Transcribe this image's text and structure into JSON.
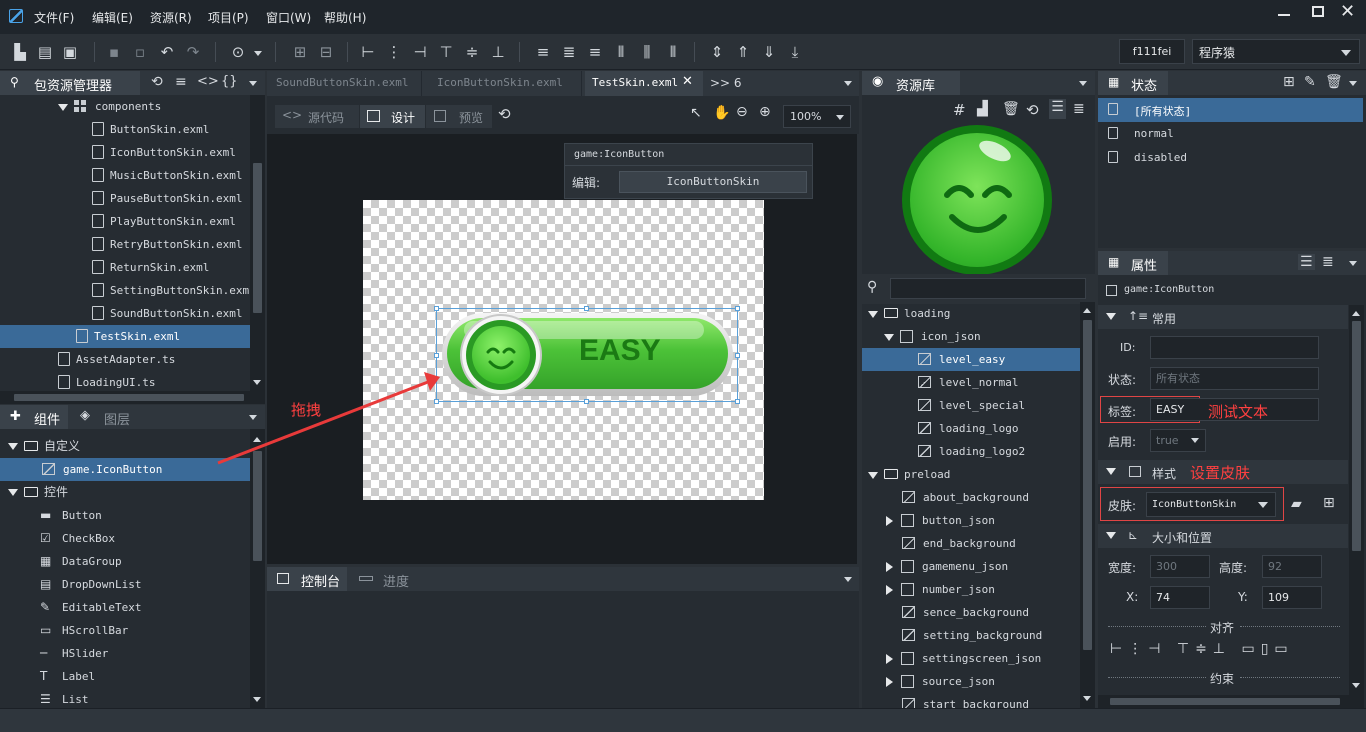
{
  "menu": [
    "文件(F)",
    "编辑(E)",
    "资源(R)",
    "项目(P)",
    "窗口(W)",
    "帮助(H)"
  ],
  "toolbar": {
    "user": "f111fei",
    "mode": "程序猿"
  },
  "package_panel": {
    "title": "包资源管理器",
    "folder": "components",
    "files": [
      "ButtonSkin.exml",
      "IconButtonSkin.exml",
      "MusicButtonSkin.exml",
      "PauseButtonSkin.exml",
      "PlayButtonSkin.exml",
      "RetryButtonSkin.exml",
      "ReturnSkin.exml",
      "SettingButtonSkin.exml",
      "SoundButtonSkin.exml"
    ],
    "selected_file": "TestSkin.exml",
    "ts_files": [
      "AssetAdapter.ts",
      "LoadingUI.ts"
    ]
  },
  "components_panel": {
    "tab_components": "组件",
    "tab_layers": "图层",
    "custom_group": "自定义",
    "custom_item": "game.IconButton",
    "controls_group": "控件",
    "controls": [
      "Button",
      "CheckBox",
      "DataGroup",
      "DropDownList",
      "EditableText",
      "HScrollBar",
      "HSlider",
      "Label",
      "List"
    ]
  },
  "editor": {
    "tabs": [
      "SoundButtonSkin.exml",
      "IconButtonSkin.exml",
      "TestSkin.exml"
    ],
    "overflow": ">> 6",
    "mode_source": "源代码",
    "mode_design": "设计",
    "mode_preview": "预览",
    "zoom": "100%",
    "popup_title": "game:IconButton",
    "popup_label": "编辑:",
    "popup_value": "IconButtonSkin",
    "button_text": "EASY",
    "drag_annotation": "拖拽"
  },
  "console": {
    "tab_console": "控制台",
    "tab_progress": "进度"
  },
  "resource_panel": {
    "title": "资源库",
    "tree": [
      {
        "label": "loading",
        "type": "folder"
      },
      {
        "label": "icon_json",
        "type": "group"
      },
      {
        "label": "level_easy",
        "type": "image",
        "selected": true
      },
      {
        "label": "level_normal",
        "type": "image"
      },
      {
        "label": "level_special",
        "type": "image"
      },
      {
        "label": "loading_logo",
        "type": "image"
      },
      {
        "label": "loading_logo2",
        "type": "image"
      },
      {
        "label": "preload",
        "type": "folder"
      },
      {
        "label": "about_background",
        "type": "image"
      },
      {
        "label": "button_json",
        "type": "group"
      },
      {
        "label": "end_background",
        "type": "image"
      },
      {
        "label": "gamemenu_json",
        "type": "group"
      },
      {
        "label": "number_json",
        "type": "group"
      },
      {
        "label": "sence_background",
        "type": "image"
      },
      {
        "label": "setting_background",
        "type": "image"
      },
      {
        "label": "settingscreen_json",
        "type": "group"
      },
      {
        "label": "source_json",
        "type": "group"
      },
      {
        "label": "start_background",
        "type": "image"
      }
    ]
  },
  "state_panel": {
    "title": "状态",
    "states": [
      "[所有状态]",
      "normal",
      "disabled"
    ]
  },
  "props_panel": {
    "title": "属性",
    "component": "game:IconButton",
    "section_common": "常用",
    "id_label": "ID:",
    "id_value": "",
    "state_label": "状态:",
    "state_placeholder": "所有状态",
    "label_label": "标签:",
    "label_value": "EASY",
    "label_note": "测试文本",
    "enabled_label": "启用:",
    "enabled_value": "true",
    "section_style": "样式",
    "style_note": "设置皮肤",
    "skin_label": "皮肤:",
    "skin_value": "IconButtonSkin",
    "section_size": "大小和位置",
    "width_label": "宽度:",
    "width_value": "300",
    "height_label": "高度:",
    "height_value": "92",
    "x_label": "X:",
    "x_value": "74",
    "y_label": "Y:",
    "y_value": "109",
    "align_label": "对齐",
    "constraint_label": "约束"
  },
  "colors": {
    "accent": "#3a6a98",
    "annotation_red": "#ff4040",
    "button_green": "#4cc238"
  }
}
